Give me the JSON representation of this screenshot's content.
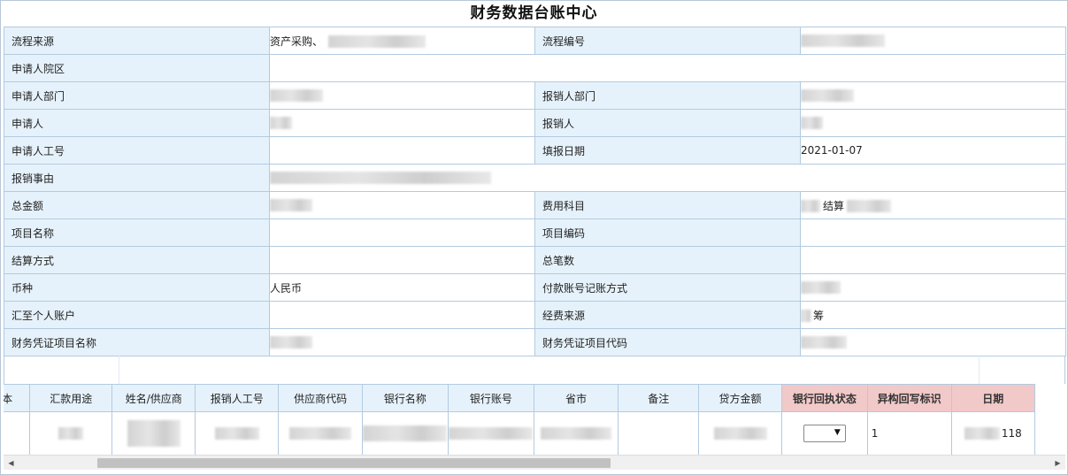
{
  "page_title": "财务数据台账中心",
  "form": {
    "rows": [
      {
        "l1": "流程来源",
        "v1": "资产采购、",
        "l2": "流程编号",
        "v2": ""
      },
      {
        "l1": "申请人院区",
        "v1": "",
        "l2": null,
        "v2": null
      },
      {
        "l1": "申请人部门",
        "v1": "",
        "l2": "报销人部门",
        "v2": ""
      },
      {
        "l1": "申请人",
        "v1": "",
        "l2": "报销人",
        "v2": ""
      },
      {
        "l1": "申请人工号",
        "v1": "",
        "l2": "填报日期",
        "v2": "2021-01-07"
      },
      {
        "l1": "报销事由",
        "v1": "",
        "l2": null,
        "v2": null
      },
      {
        "l1": "总金额",
        "v1": "",
        "l2": "费用科目",
        "v2": "结算"
      },
      {
        "l1": "项目名称",
        "v1": "",
        "l2": "项目编码",
        "v2": ""
      },
      {
        "l1": "结算方式",
        "v1": "",
        "l2": "总笔数",
        "v2": ""
      },
      {
        "l1": "币种",
        "v1": "人民币",
        "l2": "付款账号记账方式",
        "v2": ""
      },
      {
        "l1": "汇至个人账户",
        "v1": "",
        "l2": "经费来源",
        "v2": "筹"
      },
      {
        "l1": "财务凭证项目名称",
        "v1": "",
        "l2": "财务凭证项目代码",
        "v2": ""
      }
    ]
  },
  "grid": {
    "headers": [
      "文本",
      "汇款用途",
      "姓名/供应商",
      "报销人工号",
      "供应商代码",
      "银行名称",
      "银行账号",
      "省市",
      "备注",
      "贷方金额",
      "银行回执状态",
      "异构回写标识",
      "日期"
    ],
    "row": {
      "c0": "",
      "c1": "",
      "c2": "",
      "c3": "",
      "c4": "",
      "c5": "",
      "c6": "",
      "c7": "",
      "c8": "",
      "c9": "",
      "bank_status": "",
      "flag": "1",
      "date": "118"
    }
  },
  "colors": {
    "label_bg": "#e6f2fb",
    "border": "#b3cae0",
    "highlight_header": "#f2c9c9"
  },
  "icons": {
    "select_arrow": "▼",
    "scroll_left": "◀",
    "scroll_right": "▶"
  }
}
